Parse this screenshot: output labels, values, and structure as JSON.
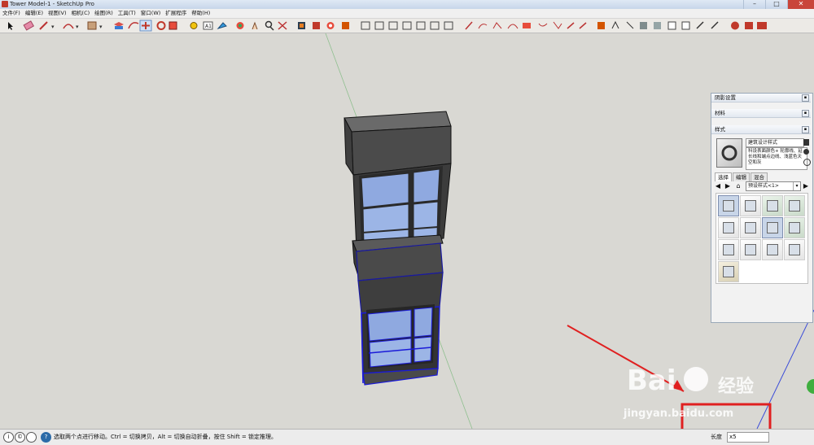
{
  "window": {
    "title": "Tower Model-1 - SketchUp Pro",
    "controls": {
      "minimize": "–",
      "maximize": "□",
      "close": "✕"
    }
  },
  "menu": [
    "文件(F)",
    "编辑(E)",
    "视图(V)",
    "相机(C)",
    "绘图(R)",
    "工具(T)",
    "窗口(W)",
    "扩展程序",
    "帮助(H)"
  ],
  "toolbar": {
    "icons": [
      "select-icon",
      "eraser-icon",
      "pencil-icon",
      "arc-icon",
      "rectangle-icon",
      "pushpull-icon",
      "offset-icon",
      "move-icon",
      "rotate-icon",
      "scale-icon",
      "tape-measure-icon",
      "text-icon",
      "paint-bucket-icon",
      "orbit-icon",
      "pan-icon",
      "zoom-icon",
      "zoom-extents-icon",
      "warehouse-icon",
      "extension-warehouse-icon",
      "component-icon",
      "standard-views-icons",
      "style-icons",
      "section-icons",
      "sandbox-icons",
      "solid-tools-icons",
      "ruby-icon"
    ],
    "active": "move-icon"
  },
  "trays": {
    "shadow": "阴影设置",
    "materials": "材料",
    "styles": "样式"
  },
  "styles_panel": {
    "style_name": "建筑设计样式",
    "description": "科设表面颜色+ 轮廓线、延长线和端点边线、浅蓝色天空和灰",
    "tabs": [
      "选择",
      "编辑",
      "混合"
    ],
    "selected_tab": "选择",
    "collection": "预设样式<1>",
    "nav": {
      "back": "◀",
      "forward": "▶",
      "home": "⌂",
      "details": "▶"
    }
  },
  "status": {
    "icons": {
      "geolocation": "i",
      "credits": "©",
      "help": "?"
    },
    "hint": "选取两个点进行移动。Ctrl = 切换拷贝，Alt = 切换自动折叠，按住 Shift = 锁定推理。"
  },
  "vcb": {
    "label": "长度",
    "value": "x5"
  },
  "watermark": {
    "brand": "Bai",
    "brand_cn": "经验",
    "site": "jingyan.baidu.com"
  }
}
